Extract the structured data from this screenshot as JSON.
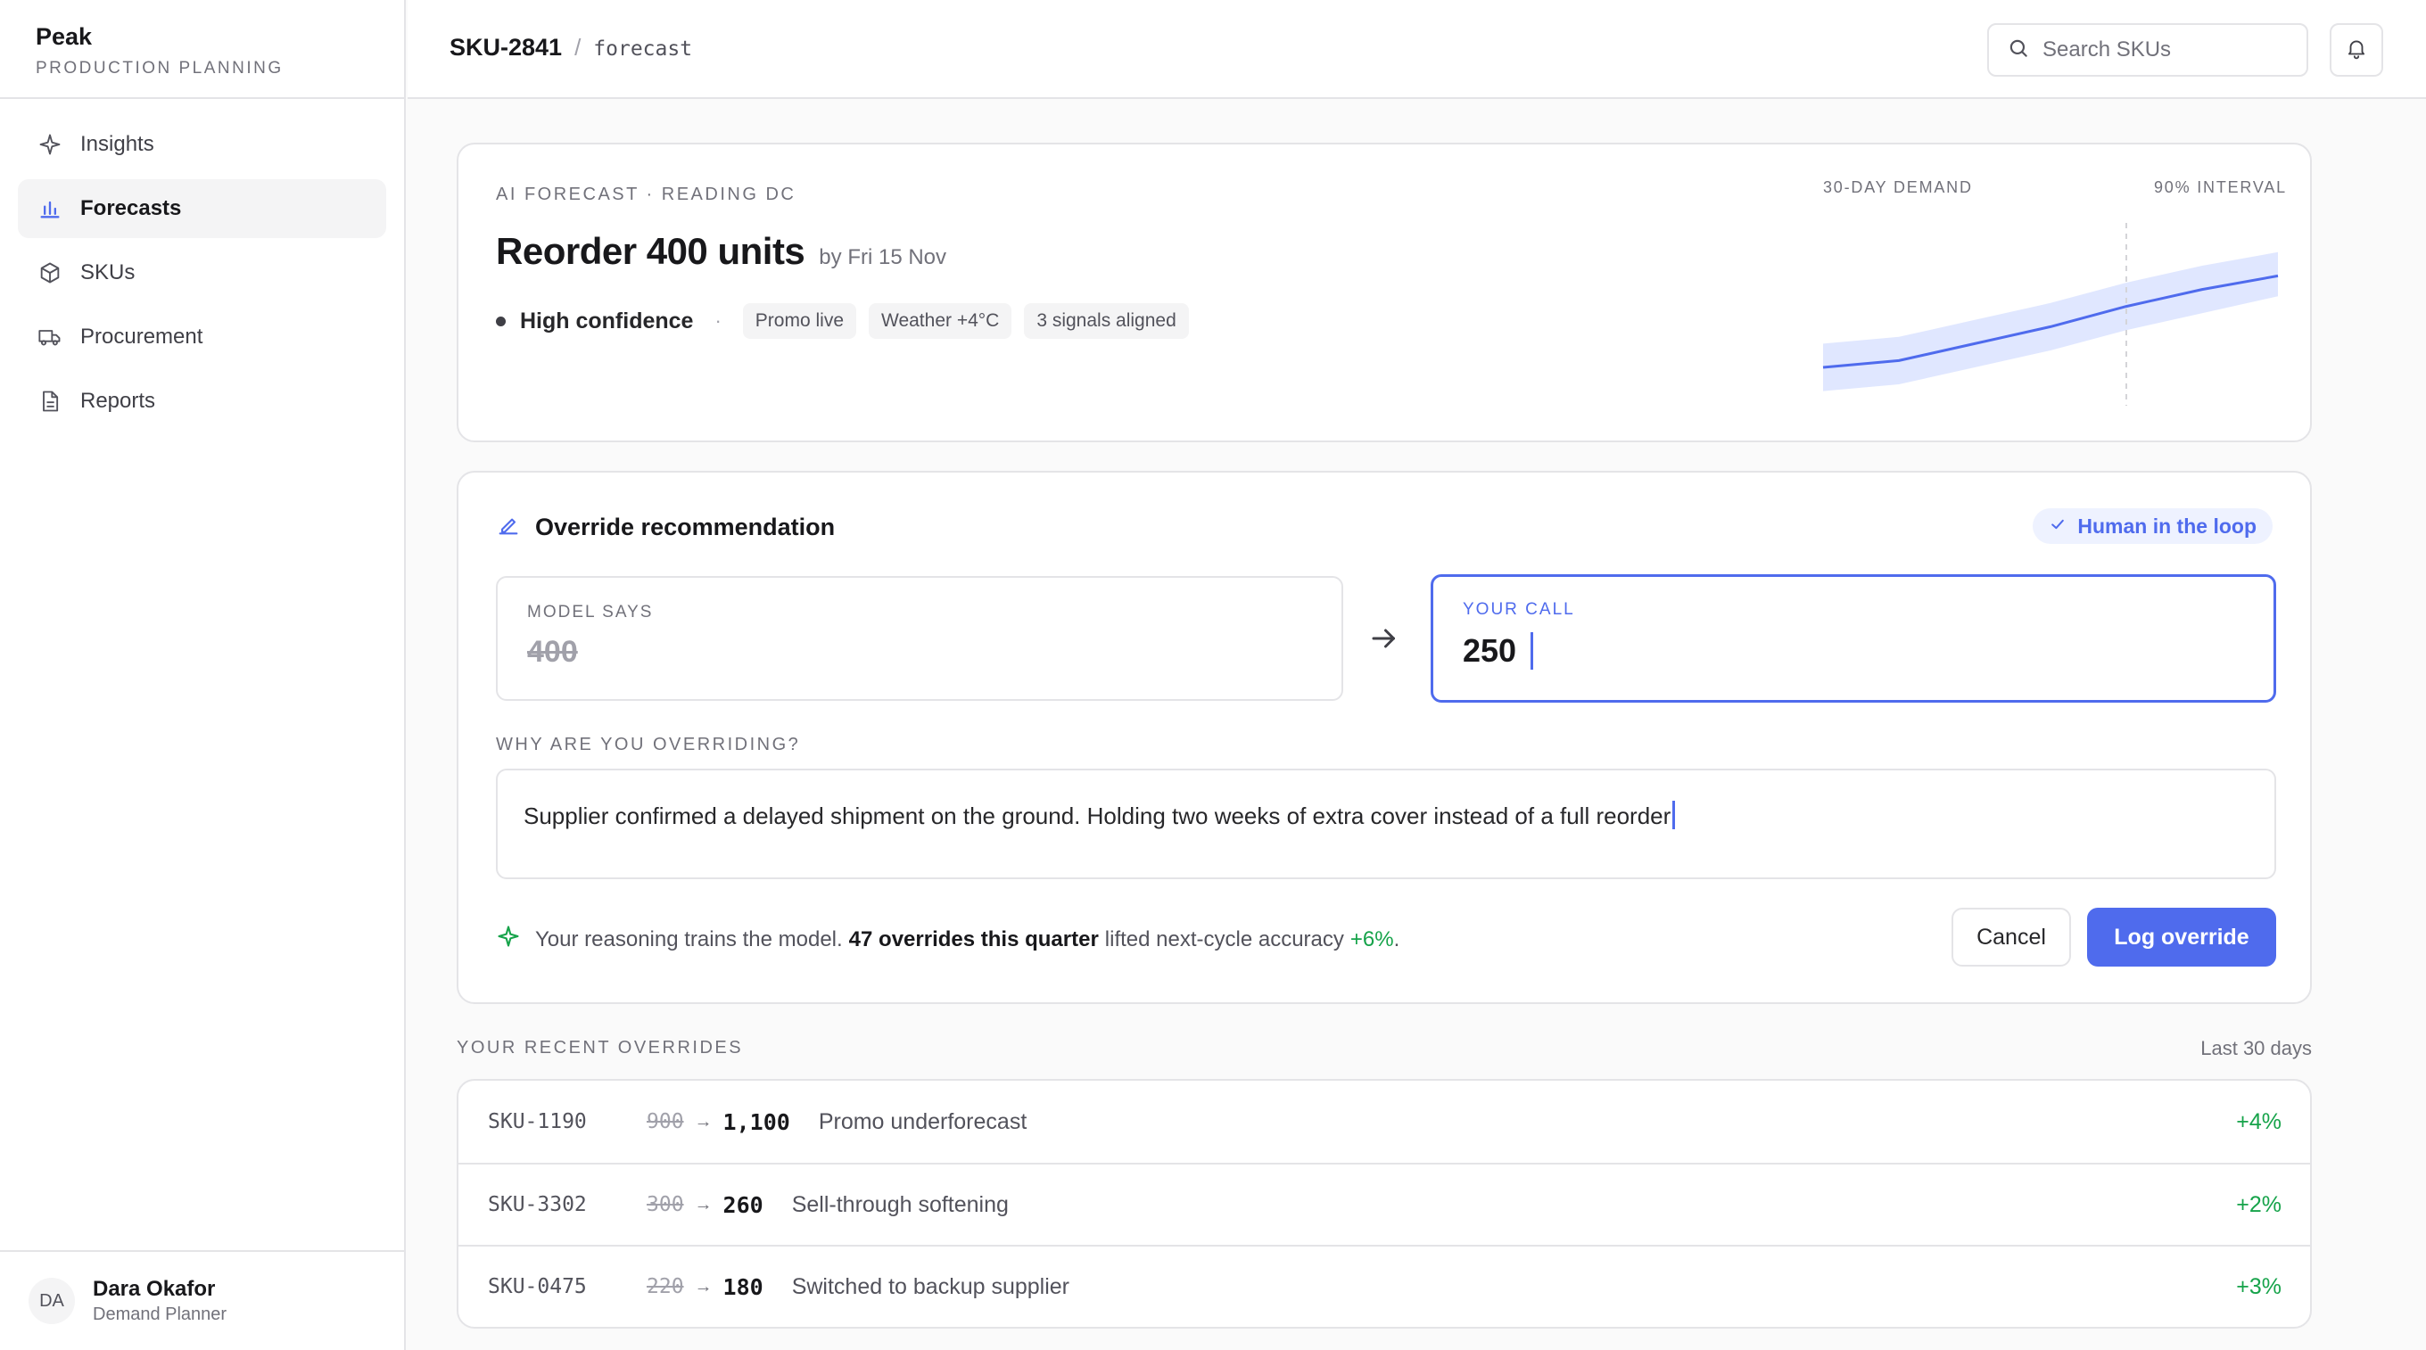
{
  "brand": {
    "name": "Peak",
    "subtitle": "PRODUCTION PLANNING"
  },
  "nav": [
    {
      "label": "Insights",
      "icon": "sparkle-icon",
      "active": false
    },
    {
      "label": "Forecasts",
      "icon": "bar-chart-icon",
      "active": true
    },
    {
      "label": "SKUs",
      "icon": "box-icon",
      "active": false
    },
    {
      "label": "Procurement",
      "icon": "truck-icon",
      "active": false
    },
    {
      "label": "Reports",
      "icon": "document-icon",
      "active": false
    }
  ],
  "user": {
    "initials": "DA",
    "name": "Dara Okafor",
    "role": "Demand Planner"
  },
  "header": {
    "sku": "SKU-2841",
    "separator": "/",
    "page": "forecast",
    "search_placeholder": "Search SKUs"
  },
  "forecast": {
    "eyebrow": "AI FORECAST · READING DC",
    "title": "Reorder 400 units",
    "by": "by Fri 15 Nov",
    "confidence": "High confidence",
    "separator": "·",
    "tags": [
      "Promo live",
      "Weather +4°C",
      "3 signals aligned"
    ],
    "chart_label_left": "30-DAY DEMAND",
    "chart_label_right": "90% INTERVAL"
  },
  "chart_data": {
    "type": "line",
    "title": "30-DAY DEMAND",
    "band_label": "90% INTERVAL",
    "x": [
      0,
      5,
      10,
      15,
      20,
      25,
      30
    ],
    "values": [
      10,
      12,
      17,
      22,
      28,
      33,
      37
    ],
    "lower": [
      3,
      5,
      10,
      15,
      21,
      26,
      31
    ],
    "upper": [
      17,
      19,
      24,
      29,
      35,
      40,
      44
    ],
    "forecast_start_x": 20,
    "ylim": [
      0,
      50
    ],
    "grid": false,
    "colors": {
      "line": "#4f6bed",
      "band": "#e0e7ff",
      "divider": "#d4d4d8"
    }
  },
  "override": {
    "title": "Override recommendation",
    "badge": "Human in the loop",
    "model_label": "MODEL SAYS",
    "model_value": "400",
    "call_label": "YOUR CALL",
    "call_value": "250",
    "why_label": "WHY ARE YOU OVERRIDING?",
    "reason": "Supplier confirmed a delayed shipment on the ground. Holding two weeks of extra cover instead of a full reorder",
    "train_pre": "Your reasoning trains the model.",
    "train_bold": "47 overrides this quarter",
    "train_mid": "lifted next-cycle accuracy",
    "train_delta": "+6%",
    "train_end": ".",
    "cancel_label": "Cancel",
    "log_label": "Log override"
  },
  "recent": {
    "label": "YOUR RECENT OVERRIDES",
    "range": "Last 30 days",
    "arrow": "→",
    "rows": [
      {
        "sku": "SKU-1190",
        "old": "900",
        "new": "1,100",
        "reason": "Promo underforecast",
        "delta": "+4%"
      },
      {
        "sku": "SKU-3302",
        "old": "300",
        "new": "260",
        "reason": "Sell-through softening",
        "delta": "+2%"
      },
      {
        "sku": "SKU-0475",
        "old": "220",
        "new": "180",
        "reason": "Switched to backup supplier",
        "delta": "+3%"
      }
    ]
  },
  "colors": {
    "accent": "#4f6bed",
    "positive": "#16a34a",
    "border": "#e4e4e7"
  }
}
